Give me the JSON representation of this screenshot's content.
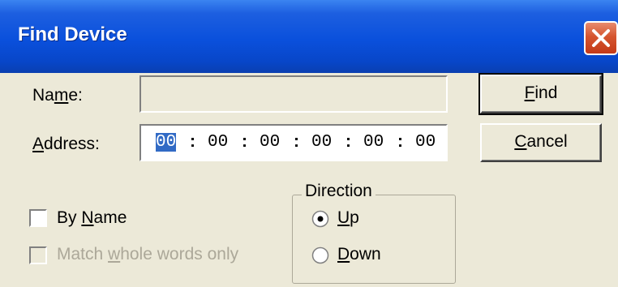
{
  "dialog": {
    "title": "Find Device",
    "close_icon": "close-icon"
  },
  "form": {
    "name_label_pre": "Na",
    "name_label_ul": "m",
    "name_label_post": "e:",
    "name_value": "",
    "address_label_ul": "A",
    "address_label_post": "ddress:",
    "address_octets": [
      "00",
      "00",
      "00",
      "00",
      "00",
      "00"
    ],
    "address_separator": ":"
  },
  "buttons": {
    "find_ul": "F",
    "find_post": "ind",
    "cancel_ul": "C",
    "cancel_post": "ancel"
  },
  "options": {
    "by_name_pre": "By ",
    "by_name_ul": "N",
    "by_name_post": "ame",
    "by_name_checked": false,
    "match_pre": "Match ",
    "match_ul": "w",
    "match_post": "hole words only",
    "match_checked": false,
    "match_enabled": false
  },
  "direction": {
    "caption": "Direction",
    "up_ul": "U",
    "up_post": "p",
    "down_ul": "D",
    "down_post": "own",
    "selected": "Up"
  }
}
